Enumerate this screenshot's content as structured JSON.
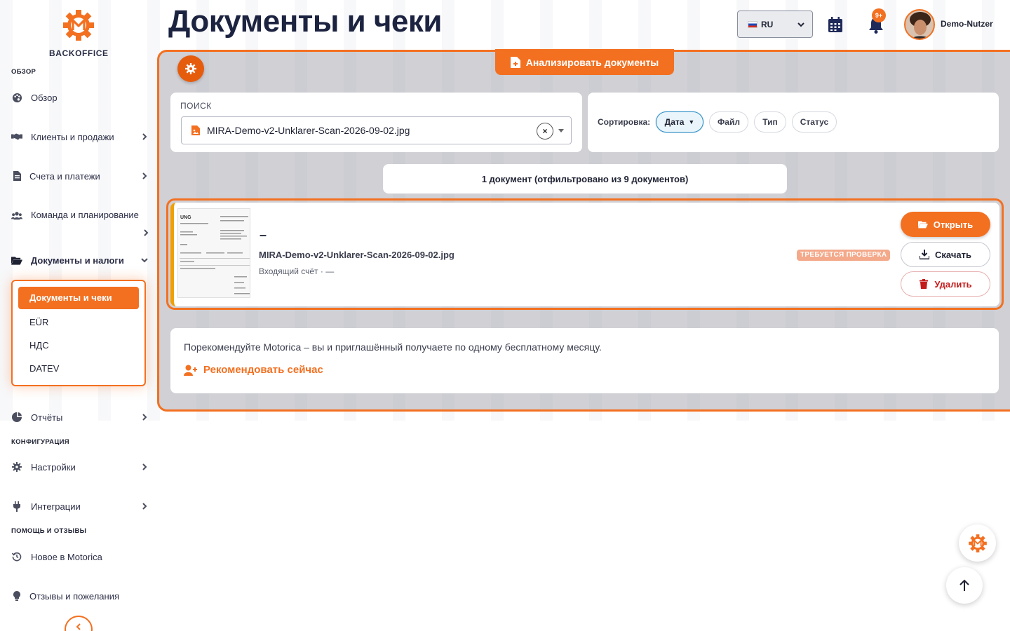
{
  "app": {
    "logo_text": "BACKOFFICE"
  },
  "sidebar": {
    "sections": [
      {
        "title": "ОБЗОР"
      },
      {
        "title": "КОНФИГУРАЦИЯ"
      },
      {
        "title": "ПОМОЩЬ И ОТЗЫВЫ"
      }
    ],
    "items": [
      {
        "label": "Обзор",
        "icon": "palette-icon"
      },
      {
        "label": "Клиенты и продажи",
        "icon": "handshake-icon"
      },
      {
        "label": "Счета и платежи",
        "icon": "invoice-icon"
      },
      {
        "label": "Команда и планирование",
        "icon": "team-icon"
      },
      {
        "label": "Документы и налоги",
        "icon": "folder-open-icon"
      },
      {
        "label": "Отчёты",
        "icon": "pie-chart-icon"
      },
      {
        "label": "Настройки",
        "icon": "gear-icon"
      },
      {
        "label": "Интеграции",
        "icon": "plug-icon"
      },
      {
        "label": "Новое в Motorica",
        "icon": "history-icon"
      },
      {
        "label": "Отзывы и пожелания",
        "icon": "lightbulb-icon"
      }
    ],
    "submenu": [
      {
        "label": "Документы и чеки",
        "active": true
      },
      {
        "label": "EÜR"
      },
      {
        "label": "НДС"
      },
      {
        "label": "DATEV"
      }
    ]
  },
  "header": {
    "title": "Документы и чеки",
    "language": "RU",
    "notifications_badge": "9+",
    "user_name": "Demo-Nutzer"
  },
  "toolbar": {
    "analyze_label": "Анализировать документы"
  },
  "search": {
    "label": "ПОИСК",
    "value": "MIRA-Demo-v2-Unklarer-Scan-2026-09-02.jpg",
    "clear_symbol": "×"
  },
  "sort": {
    "label": "Сортировка:",
    "options": [
      {
        "label": "Дата",
        "active": true,
        "indicator": "▼"
      },
      {
        "label": "Файл"
      },
      {
        "label": "Тип"
      },
      {
        "label": "Статус"
      }
    ]
  },
  "results": {
    "summary": "1 документ (отфильтровано из 9 документов)"
  },
  "document": {
    "title": "–",
    "filename": "MIRA-Demo-v2-Unklarer-Scan-2026-09-02.jpg",
    "meta": "Входящий счёт · —",
    "status": "ТРЕБУЕТСЯ ПРОВЕРКА",
    "open_label": "Открыть",
    "download_label": "Скачать",
    "delete_label": "Удалить"
  },
  "referral": {
    "text": "Порекомендуйте Motorica – вы и приглашённый получаете по одному бесплатному месяцу.",
    "link_label": "Рекомендовать сейчас"
  },
  "colors": {
    "accent": "#f37021",
    "dark": "#1c2340",
    "danger": "#c41b1b",
    "status_badge": "#f4a98a"
  }
}
